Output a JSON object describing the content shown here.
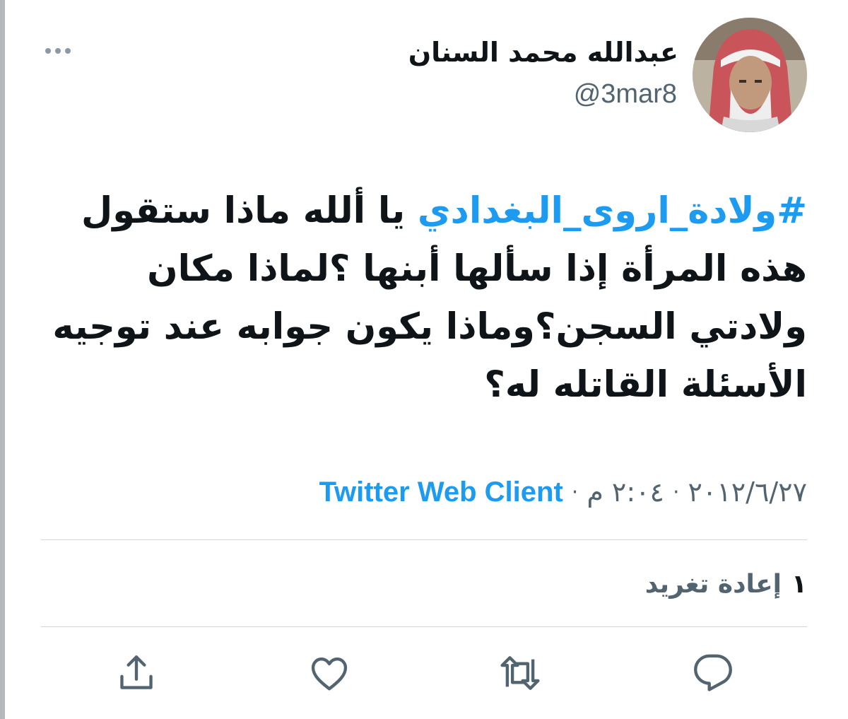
{
  "tweet": {
    "author": {
      "display_name": "عبدالله محمد السنان",
      "handle": "@3mar8"
    },
    "text": {
      "hashtag": "#ولادة_اروى_البغدادي",
      "body": " يا ألله ماذا ستقول هذه المرأة إذا سألها أبنها ؟لماذا مكان ولادتي السجن؟وماذا يكون جوابه عند توجيه الأسئلة القاتله له؟"
    },
    "meta": {
      "date": "٢٠١٢/٦/٢٧",
      "separator": "·",
      "time": "٢:٠٤ م",
      "source": "Twitter Web Client"
    },
    "stats": {
      "retweet_count": "١",
      "retweet_label": "إعادة تغريد"
    }
  },
  "icons": {
    "more": "more-horizontal-icon",
    "reply": "reply-icon",
    "retweet": "retweet-icon",
    "like": "heart-icon",
    "share": "share-icon"
  },
  "colors": {
    "link": "#1d9bf0",
    "secondary_text": "#536471",
    "primary_text": "#0f1419",
    "divider": "#cfd9de"
  }
}
